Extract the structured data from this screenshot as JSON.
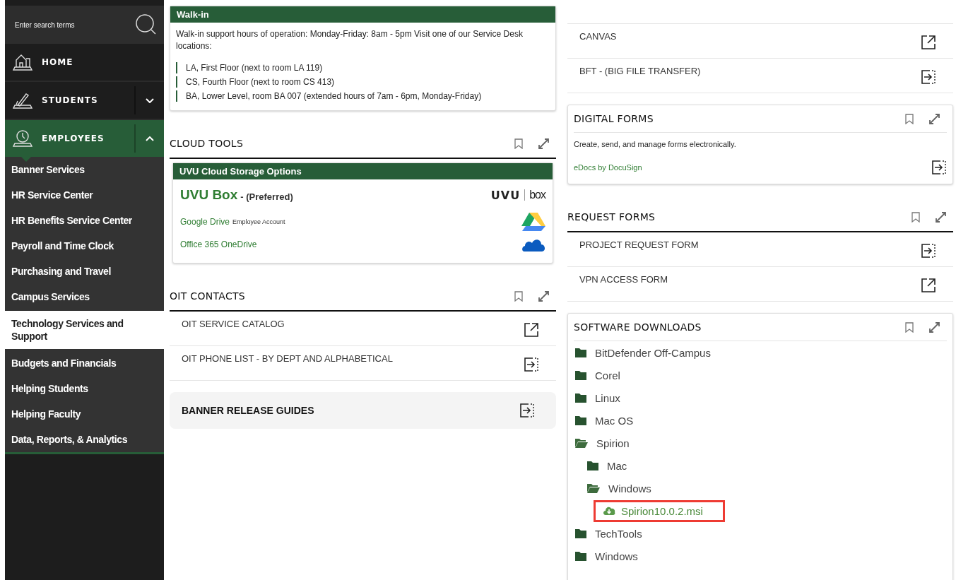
{
  "sidebar": {
    "search": {
      "placeholder": "Enter search terms"
    },
    "nav": [
      {
        "label": "HOME",
        "kind": "link"
      },
      {
        "label": "STUDENTS",
        "kind": "group",
        "expanded": false
      },
      {
        "label": "EMPLOYEES",
        "kind": "group",
        "expanded": true
      }
    ],
    "subitems": [
      {
        "label": "Banner Services",
        "selected": false
      },
      {
        "label": "HR Service Center",
        "selected": false
      },
      {
        "label": "HR Benefits Service Center",
        "selected": false
      },
      {
        "label": "Payroll and Time Clock",
        "selected": false
      },
      {
        "label": "Purchasing and Travel",
        "selected": false
      },
      {
        "label": "Campus Services",
        "selected": false
      },
      {
        "label": "Technology Services and Support",
        "selected": true
      },
      {
        "label": "Budgets and Financials",
        "selected": false
      },
      {
        "label": "Helping Students",
        "selected": false
      },
      {
        "label": "Helping Faculty",
        "selected": false
      },
      {
        "label": "Data, Reports, & Analytics",
        "selected": false
      }
    ]
  },
  "walk_in": {
    "title": "Walk-in",
    "text": "Walk-in support hours of operation: Monday-Friday: 8am - 5pm Visit one of our Service Desk locations:",
    "locations": [
      "LA, First Floor (next to room LA 119)",
      "CS, Fourth Floor (next to room CS 413)",
      "BA, Lower Level, room BA 007 (extended hours of 7am - 6pm, Monday-Friday)"
    ]
  },
  "cloud_tools": {
    "title": "CLOUD TOOLS",
    "card": {
      "title": "UVU Cloud Storage Options",
      "primary": {
        "name": "UVU Box",
        "note": "- (Preferred)",
        "logo": [
          "UVU",
          "box"
        ]
      },
      "links": [
        {
          "label": "Google Drive",
          "note": "Employee Account",
          "kind": "drive"
        },
        {
          "label": "Office 365 OneDrive",
          "kind": "onedrive"
        }
      ]
    }
  },
  "oit_contacts": {
    "title": "OIT CONTACTS",
    "links": [
      {
        "label": "OIT SERVICE CATALOG",
        "kind": "external"
      },
      {
        "label": "OIT PHONE LIST - BY DEPT AND ALPHABETICAL",
        "kind": "enter"
      }
    ]
  },
  "banner_release": {
    "label": "BANNER RELEASE GUIDES",
    "kind": "enter"
  },
  "top_links": [
    {
      "label": "CANVAS",
      "kind": "external"
    },
    {
      "label": "BFT - (BIG FILE TRANSFER)",
      "kind": "enter"
    }
  ],
  "digital_forms": {
    "title": "DIGITAL FORMS",
    "text": "Create, send, and manage forms electronically.",
    "link": {
      "label": "eDocs by DocuSign",
      "kind": "enter"
    }
  },
  "request_forms": {
    "title": "REQUEST FORMS",
    "links": [
      {
        "label": "PROJECT REQUEST FORM",
        "kind": "enter"
      },
      {
        "label": "VPN ACCESS FORM",
        "kind": "external"
      }
    ]
  },
  "software_downloads": {
    "title": "SOFTWARE DOWNLOADS",
    "tree": [
      {
        "label": "BitDefender Off-Campus",
        "kind": "folder",
        "expanded": false
      },
      {
        "label": "Corel",
        "kind": "folder",
        "expanded": false
      },
      {
        "label": "Linux",
        "kind": "folder",
        "expanded": false
      },
      {
        "label": "Mac OS",
        "kind": "folder",
        "expanded": false
      },
      {
        "label": "Spirion",
        "kind": "folder",
        "expanded": true,
        "children": [
          {
            "label": "Mac",
            "kind": "folder",
            "expanded": false
          },
          {
            "label": "Windows",
            "kind": "folder",
            "expanded": true,
            "children": [
              {
                "label": "Spirion10.0.2.msi",
                "kind": "file",
                "highlighted": true
              }
            ]
          }
        ]
      },
      {
        "label": "TechTools",
        "kind": "folder",
        "expanded": false
      },
      {
        "label": "Windows",
        "kind": "folder",
        "expanded": false
      }
    ]
  }
}
